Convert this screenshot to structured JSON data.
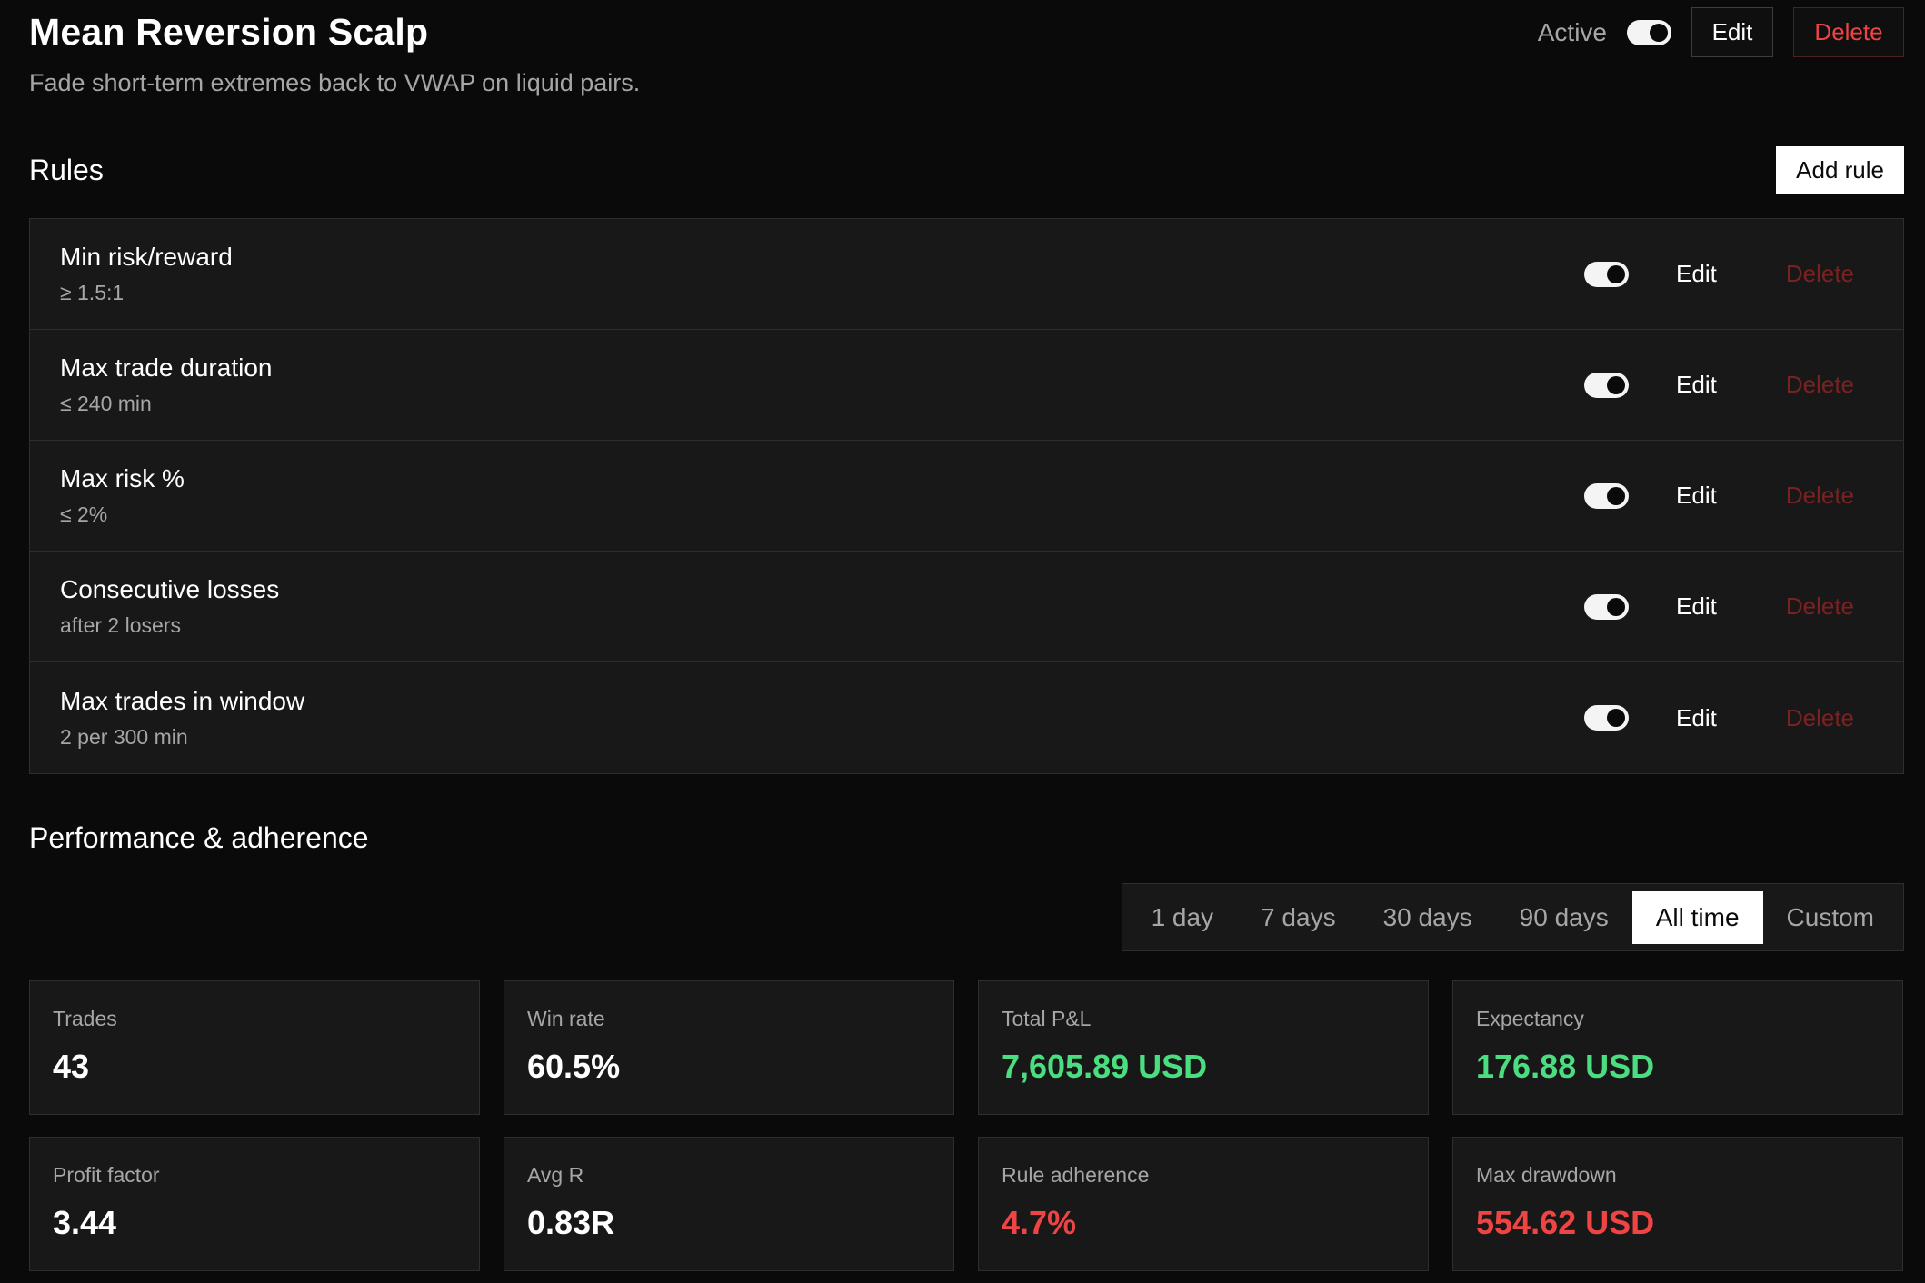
{
  "strategy": {
    "title": "Mean Reversion Scalp",
    "subtitle": "Fade short-term extremes back to VWAP on liquid pairs.",
    "active_label": "Active",
    "edit_label": "Edit",
    "delete_label": "Delete"
  },
  "rules": {
    "section_title": "Rules",
    "add_label": "Add rule",
    "edit_label": "Edit",
    "delete_label": "Delete",
    "items": [
      {
        "name": "Min risk/reward",
        "desc": "≥ 1.5:1"
      },
      {
        "name": "Max trade duration",
        "desc": "≤ 240 min"
      },
      {
        "name": "Max risk %",
        "desc": "≤ 2%"
      },
      {
        "name": "Consecutive losses",
        "desc": "after 2 losers"
      },
      {
        "name": "Max trades in window",
        "desc": "2 per 300 min"
      }
    ]
  },
  "performance": {
    "section_title": "Performance & adherence",
    "ranges": [
      "1 day",
      "7 days",
      "30 days",
      "90 days",
      "All time",
      "Custom"
    ],
    "selected_range": "All time",
    "stats": [
      {
        "label": "Trades",
        "value": "43",
        "tone": "neutral"
      },
      {
        "label": "Win rate",
        "value": "60.5%",
        "tone": "neutral"
      },
      {
        "label": "Total P&L",
        "value": "7,605.89 USD",
        "tone": "positive"
      },
      {
        "label": "Expectancy",
        "value": "176.88 USD",
        "tone": "positive"
      },
      {
        "label": "Profit factor",
        "value": "3.44",
        "tone": "neutral"
      },
      {
        "label": "Avg R",
        "value": "0.83R",
        "tone": "neutral"
      },
      {
        "label": "Rule adherence",
        "value": "4.7%",
        "tone": "negative"
      },
      {
        "label": "Max drawdown",
        "value": "554.62 USD",
        "tone": "negative"
      }
    ]
  },
  "colors": {
    "positive": "#4ade80",
    "negative": "#ef4444",
    "delete_muted": "#7a2222"
  }
}
